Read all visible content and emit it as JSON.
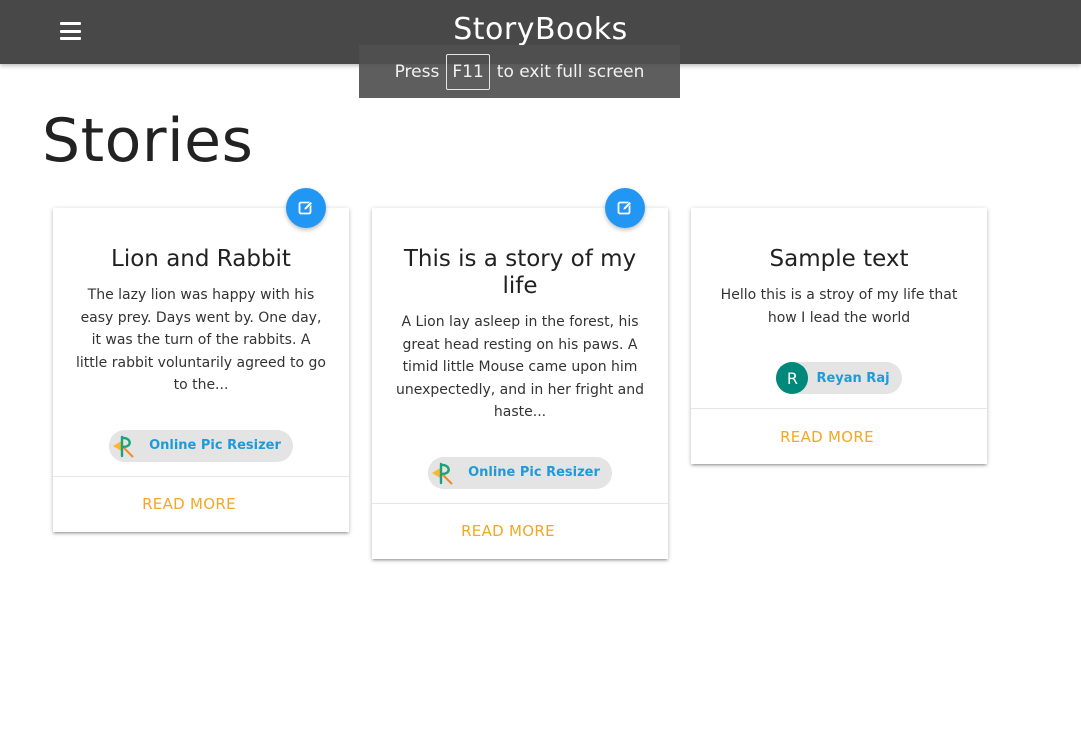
{
  "navbar": {
    "brand": "StoryBooks",
    "menu_icon": "hamburger-menu-icon"
  },
  "fullscreen_notice": {
    "before": "Press",
    "key": "F11",
    "after": "to exit full screen"
  },
  "page": {
    "title": "Stories"
  },
  "stories": [
    {
      "title": "Lion and Rabbit",
      "excerpt": "The lazy lion was happy with his easy prey. Days went by. One day, it was the turn of the rabbits. A little rabbit voluntarily agreed to go to the...",
      "author": "Online Pic Resizer",
      "avatar_type": "logo",
      "read_more": "READ MORE",
      "editable": true
    },
    {
      "title": "This is a story of my life",
      "excerpt": "A Lion lay asleep in the forest, his great head resting on his paws. A timid little Mouse came upon him unexpectedly, and in her fright and haste...",
      "author": "Online Pic Resizer",
      "avatar_type": "logo",
      "read_more": "READ MORE",
      "editable": true
    },
    {
      "title": "Sample text",
      "excerpt": "Hello this is a stroy of my life that how I lead the world",
      "author": "Reyan Raj",
      "avatar_type": "letter",
      "avatar_letter": "R",
      "read_more": "READ MORE",
      "editable": false
    }
  ],
  "colors": {
    "navbar": "#484848",
    "accent_link": "#f5a623",
    "fab": "#2196f3",
    "author_link": "#1e9bd7",
    "avatar_letter_bg": "#00897b"
  }
}
